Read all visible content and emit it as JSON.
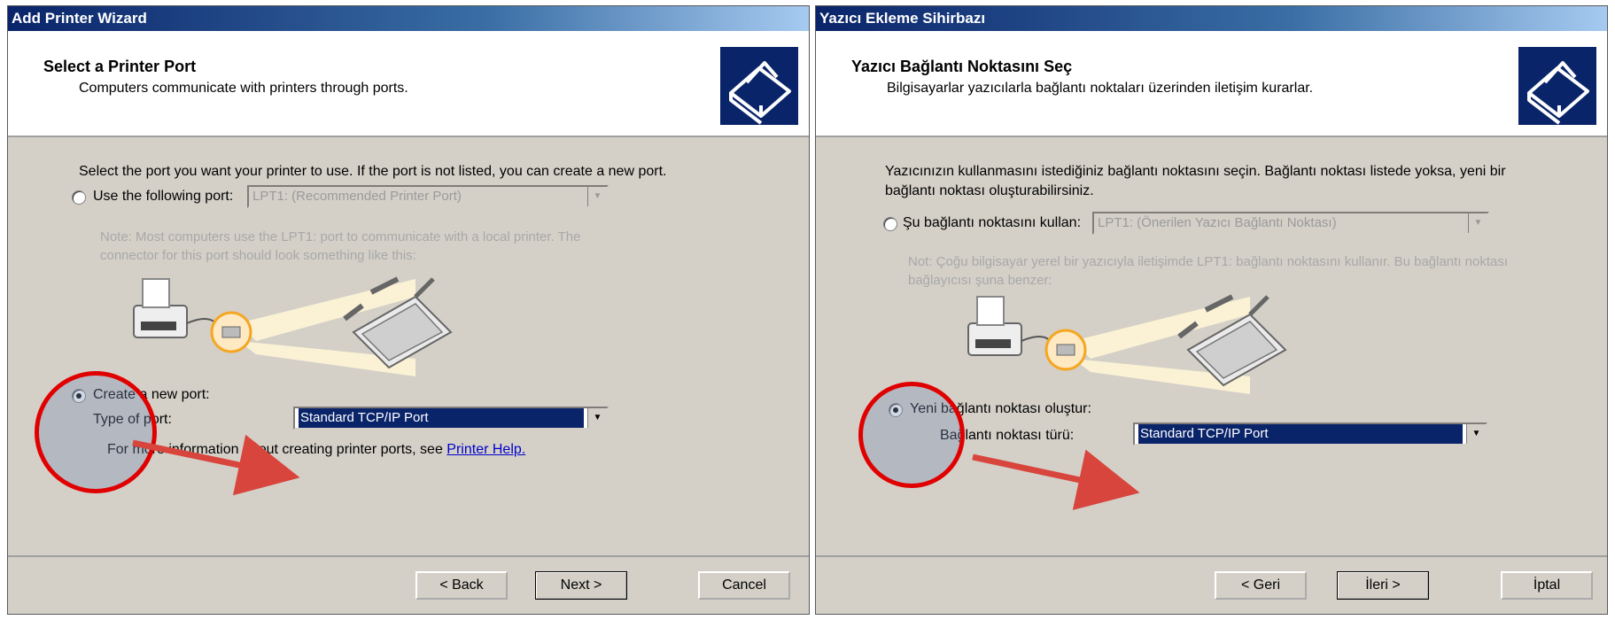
{
  "left": {
    "title": "Add Printer Wizard",
    "heading": "Select a Printer Port",
    "subheading": "Computers communicate with printers through ports.",
    "intro": "Select the port you want your printer to use.  If the port is not listed, you can create a new port.",
    "use_port_label": "Use the following port:",
    "use_port_value": "LPT1: (Recommended Printer Port)",
    "note": "Note: Most computers use the LPT1: port to communicate with a local printer. The connector for this port should look something like this:",
    "create_label": "Create a new port:",
    "type_label": "Type of port:",
    "type_value": "Standard TCP/IP Port",
    "help_text": "For more information about creating printer ports, see",
    "help_link": "Printer Help.",
    "back": "< Back",
    "next": "Next >",
    "cancel": "Cancel"
  },
  "right": {
    "title": "Yazıcı Ekleme Sihirbazı",
    "heading": "Yazıcı Bağlantı Noktasını Seç",
    "subheading": "Bilgisayarlar yazıcılarla bağlantı noktaları üzerinden iletişim kurarlar.",
    "intro": "Yazıcınızın kullanmasını istediğiniz bağlantı noktasını seçin. Bağlantı noktası listede yoksa, yeni bir bağlantı noktası oluşturabilirsiniz.",
    "use_port_label": "Şu bağlantı noktasını kullan:",
    "use_port_value": "LPT1: (Önerilen Yazıcı Bağlantı Noktası)",
    "note": "Not: Çoğu bilgisayar yerel bir yazıcıyla iletişimde LPT1: bağlantı noktasını kullanır. Bu bağlantı noktası bağlayıcısı şuna benzer:",
    "create_label": "Yeni bağlantı noktası oluştur:",
    "type_label": "Bağlantı noktası türü:",
    "type_value": "Standard TCP/IP Port",
    "back": "< Geri",
    "next": "İleri >",
    "cancel": "İptal"
  },
  "colors": {
    "title_bar": "#0a246a",
    "dialog_face": "#d4d0c8",
    "highlight": "#0a246a",
    "annotation": "#e00000"
  }
}
